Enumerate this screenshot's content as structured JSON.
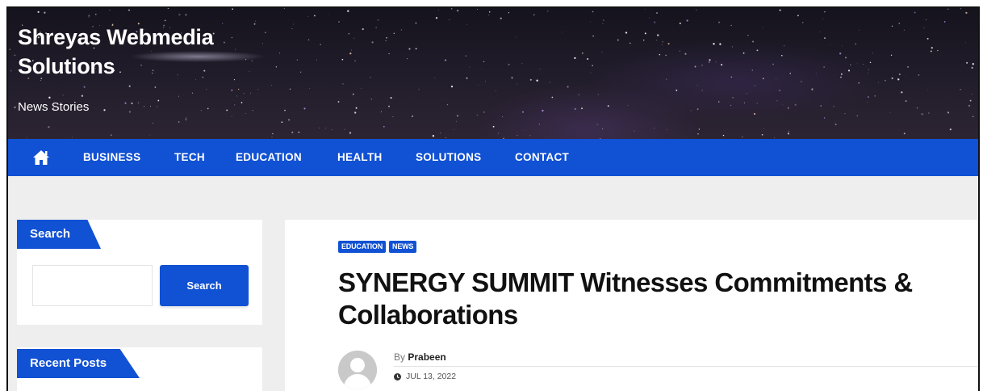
{
  "site": {
    "title": "Shreyas Webmedia Solutions",
    "title_line1": "Shreyas Webmedia",
    "title_line2": "Solutions",
    "tagline": "News Stories"
  },
  "nav": {
    "home_icon": "home-icon",
    "items": [
      {
        "label": "BUSINESS"
      },
      {
        "label": "TECH"
      },
      {
        "label": "EDUCATION"
      },
      {
        "label": "HEALTH"
      },
      {
        "label": "SOLUTIONS"
      },
      {
        "label": "CONTACT"
      }
    ]
  },
  "sidebar": {
    "search_widget": {
      "title": "Search",
      "input_value": "",
      "button_label": "Search"
    },
    "recent_posts_widget": {
      "title": "Recent Posts"
    }
  },
  "article": {
    "categories": [
      "EDUCATION",
      "NEWS"
    ],
    "title": "SYNERGY SUMMIT Witnesses Commitments & Collaborations",
    "title_line1": "SYNERGY SUMMIT Witnesses Commitments &",
    "title_line2": "Collaborations",
    "by_prefix": "By",
    "author": "Prabeen",
    "date": "JUL 13, 2022",
    "date_icon": "clock-icon",
    "avatar_icon": "user-avatar-icon"
  },
  "colors": {
    "accent": "#1151d3",
    "page_background": "#eeeeee",
    "header_background": "#1d1a26"
  }
}
